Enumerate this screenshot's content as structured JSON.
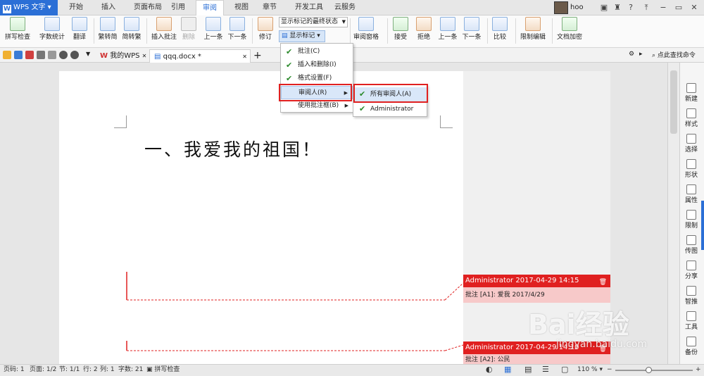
{
  "app": {
    "title": "WPS 文字",
    "logo_letter": "W"
  },
  "menu_tabs": [
    "开始",
    "插入",
    "页面布局",
    "引用",
    "审阅",
    "视图",
    "章节",
    "开发工具",
    "云服务"
  ],
  "active_tab": "审阅",
  "user": {
    "name": "hoo"
  },
  "ribbon": {
    "spell": "拼写检查",
    "wordcount": "字数统计",
    "translate": "翻译",
    "trad_to_simp": "繁转简",
    "simp_to_trad": "简转繁",
    "insert_comment": "插入批注",
    "delete": "删除",
    "prev": "上一条",
    "next": "下一条",
    "track": "修订",
    "final_state": "显示标记的最终状态",
    "show_markup": "显示标记",
    "review_pane": "审阅窗格",
    "accept": "接受",
    "reject": "拒绝",
    "prev2": "上一条",
    "next2": "下一条",
    "compare": "比较",
    "restrict": "限制编辑",
    "encrypt": "文档加密"
  },
  "tabs": {
    "mywps": "我的WPS",
    "doc": "qqq.docx *",
    "add": "+",
    "search": "点此查找命令"
  },
  "document": {
    "heading": "一、我爱我的祖国！"
  },
  "show_markup_menu": [
    {
      "label": "批注(C)",
      "checked": true
    },
    {
      "label": "插入和删除(I)",
      "checked": true
    },
    {
      "label": "格式设置(F)",
      "checked": true
    },
    {
      "label": "审阅人(R)",
      "checked": false
    },
    {
      "label": "使用批注框(B)",
      "checked": false
    }
  ],
  "reviewers_menu": [
    {
      "label": "所有审阅人(A)",
      "checked": true
    },
    {
      "label": "Administrator",
      "checked": true
    }
  ],
  "comments": [
    {
      "header": "Administrator 2017-04-29 14:15",
      "body": "批注 [A1]: 爱我 2017/4/29"
    },
    {
      "header": "Administrator 2017-04-29 14:10",
      "body": "批注 [A2]: 公民"
    }
  ],
  "sidebar": [
    "新建",
    "样式",
    "选择",
    "形状",
    "属性",
    "限制",
    "传图",
    "分享",
    "智推",
    "工具",
    "备份"
  ],
  "status": {
    "page": "页码: 1",
    "pages": "页面: 1/2",
    "section": "节: 1/1",
    "row": "行: 2",
    "col": "列: 1",
    "words": "字数: 21",
    "spell": "拼写检查",
    "zoom": "110 %"
  },
  "watermark": {
    "main": "Bai经验",
    "sub": "jingyan.baidu.com"
  },
  "colors": {
    "accent": "#2b6fd6",
    "comment_header": "#e02020",
    "comment_body": "#f7c9c9"
  }
}
